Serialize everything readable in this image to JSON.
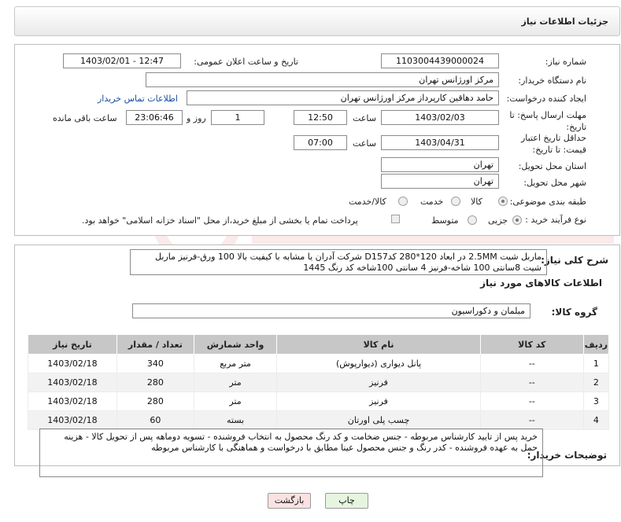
{
  "header": {
    "title": "جزئیات اطلاعات نیاز"
  },
  "fields": {
    "need_number_label": "شماره نیاز:",
    "need_number": "1103004439000024",
    "announce_label": "تاریخ و ساعت اعلان عمومی:",
    "announce_value": "1403/02/01 - 12:47",
    "buyer_org_label": "نام دستگاه خریدار:",
    "buyer_org": "مرکز اورژانس تهران",
    "creator_label": "ایجاد کننده درخواست:",
    "creator": "حامد دهاقین کارپرداز مرکز اورژانس تهران",
    "contact_link": "اطلاعات تماس خریدار",
    "deadline_label": "مهلت ارسال پاسخ: تا تاریخ:",
    "deadline_date": "1403/02/03",
    "time_label": "ساعت",
    "deadline_time": "12:50",
    "days_value": "1",
    "days_label": "روز و",
    "remaining_time": "23:06:46",
    "remaining_label": "ساعت باقی مانده",
    "validity_label": "حداقل تاریخ اعتبار قیمت: تا تاریخ:",
    "validity_date": "1403/04/31",
    "validity_time": "07:00",
    "province_label": "استان محل تحویل:",
    "province": "تهران",
    "city_label": "شهر محل تحویل:",
    "city": "تهران",
    "category_label": "طبقه بندی موضوعی:",
    "category_options": [
      "کالا",
      "خدمت",
      "کالا/خدمت"
    ],
    "process_label": "نوع فرآیند خرید :",
    "process_options": [
      "جزیی",
      "متوسط"
    ],
    "payment_note": "پرداخت تمام یا بخشی از مبلغ خرید،از محل \"اسناد خزانه اسلامی\" خواهد بود."
  },
  "description": {
    "label": "شرح کلی نیاز:",
    "text": "ماربل شیت 2.5MM در ابعاد 120*280 کدD157 شرکت آدران یا مشابه با کیفیت بالا 100 ورق-فرنیز ماربل شیت 8سانتی 100 شاخه-فرنیز 4 سانتی 100شاخه کد رنگ 1445"
  },
  "goods": {
    "section_title": "اطلاعات کالاهای مورد نیاز",
    "group_label": "گروه کالا:",
    "group_value": "مبلمان و دکوراسیون",
    "columns": [
      "ردیف",
      "کد کالا",
      "نام کالا",
      "واحد شمارش",
      "تعداد / مقدار",
      "تاریخ نیاز"
    ],
    "rows": [
      [
        "1",
        "--",
        "پانل دیواری (دیوارپوش)",
        "متر مربع",
        "340",
        "1403/02/18"
      ],
      [
        "2",
        "--",
        "فرنیز",
        "متر",
        "280",
        "1403/02/18"
      ],
      [
        "3",
        "--",
        "فرنیز",
        "متر",
        "280",
        "1403/02/18"
      ],
      [
        "4",
        "--",
        "چسب پلی اورتان",
        "بسته",
        "60",
        "1403/02/18"
      ]
    ]
  },
  "buyer_notes": {
    "label": "توضیحات خریدار:",
    "text": "خرید پس از تایید کارشناس مربوطه - جنس ضخامت و کد رنگ محصول به انتخاب فروشنده - تسویه دوماهه پس از تحویل کالا - هزینه حمل به عهده فروشنده - کدر رنگ و جنس محصول عینا مطابق با درخواست و هماهنگی با کارشناس مربوطه"
  },
  "buttons": {
    "print": "چاپ",
    "back": "بازگشت"
  },
  "colors": {
    "print_bg": "#e6f5e0",
    "back_bg": "#fbe1e1",
    "link": "#1a4fa3",
    "table_header": "#c7c7c7"
  }
}
